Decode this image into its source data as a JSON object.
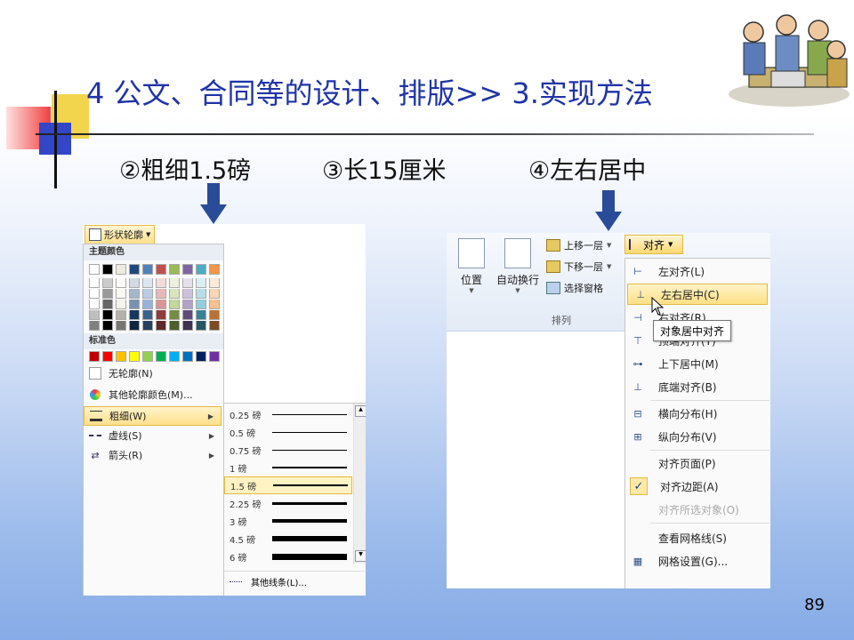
{
  "slide": {
    "title": "4 公文、合同等的设计、排版>> 3.实现方法",
    "subtitles": [
      "②粗细1.5磅",
      "③长15厘米",
      "④左右居中"
    ],
    "page_number": "89"
  },
  "left_panel": {
    "button_label": "形状轮廓",
    "theme_colors_label": "主题颜色",
    "standard_colors_label": "标准色",
    "no_outline": "无轮廓(N)",
    "more_colors": "其他轮廓颜色(M)...",
    "weight": "粗细(W)",
    "dashes": "虚线(S)",
    "arrows": "箭头(R)",
    "weights": [
      "0.25 磅",
      "0.5 磅",
      "0.75 磅",
      "1 磅",
      "1.5 磅",
      "2.25 磅",
      "3 磅",
      "4.5 磅",
      "6 磅"
    ],
    "more_lines": "其他线条(L)...",
    "theme_top_row": [
      "#ffffff",
      "#000000",
      "#eeece1",
      "#1f497d",
      "#4f81bd",
      "#c0504d",
      "#9bbb59",
      "#8064a2",
      "#4bacc6",
      "#f79646"
    ],
    "standard_row": [
      "#c00000",
      "#ff0000",
      "#ffc000",
      "#ffff00",
      "#92d050",
      "#00b050",
      "#00b0f0",
      "#0070c0",
      "#002060",
      "#7030a0"
    ]
  },
  "right_panel": {
    "position": "位置",
    "wrap_text": "自动换行",
    "bring_forward": "上移一层",
    "send_backward": "下移一层",
    "selection_pane": "选择窗格",
    "group_label": "排列",
    "align_button": "对齐",
    "tooltip": "对象居中对齐",
    "items": {
      "left": "左对齐(L)",
      "center": "左右居中(C)",
      "right": "右对齐(R)",
      "top": "顶端对齐(T)",
      "middle": "上下居中(M)",
      "bottom": "底端对齐(B)",
      "dist_h": "横向分布(H)",
      "dist_v": "纵向分布(V)",
      "to_page": "对齐页面(P)",
      "to_margin": "对齐边距(A)",
      "selected": "对齐所选对象(O)",
      "gridlines": "查看网格线(S)",
      "grid_settings": "网格设置(G)..."
    }
  }
}
